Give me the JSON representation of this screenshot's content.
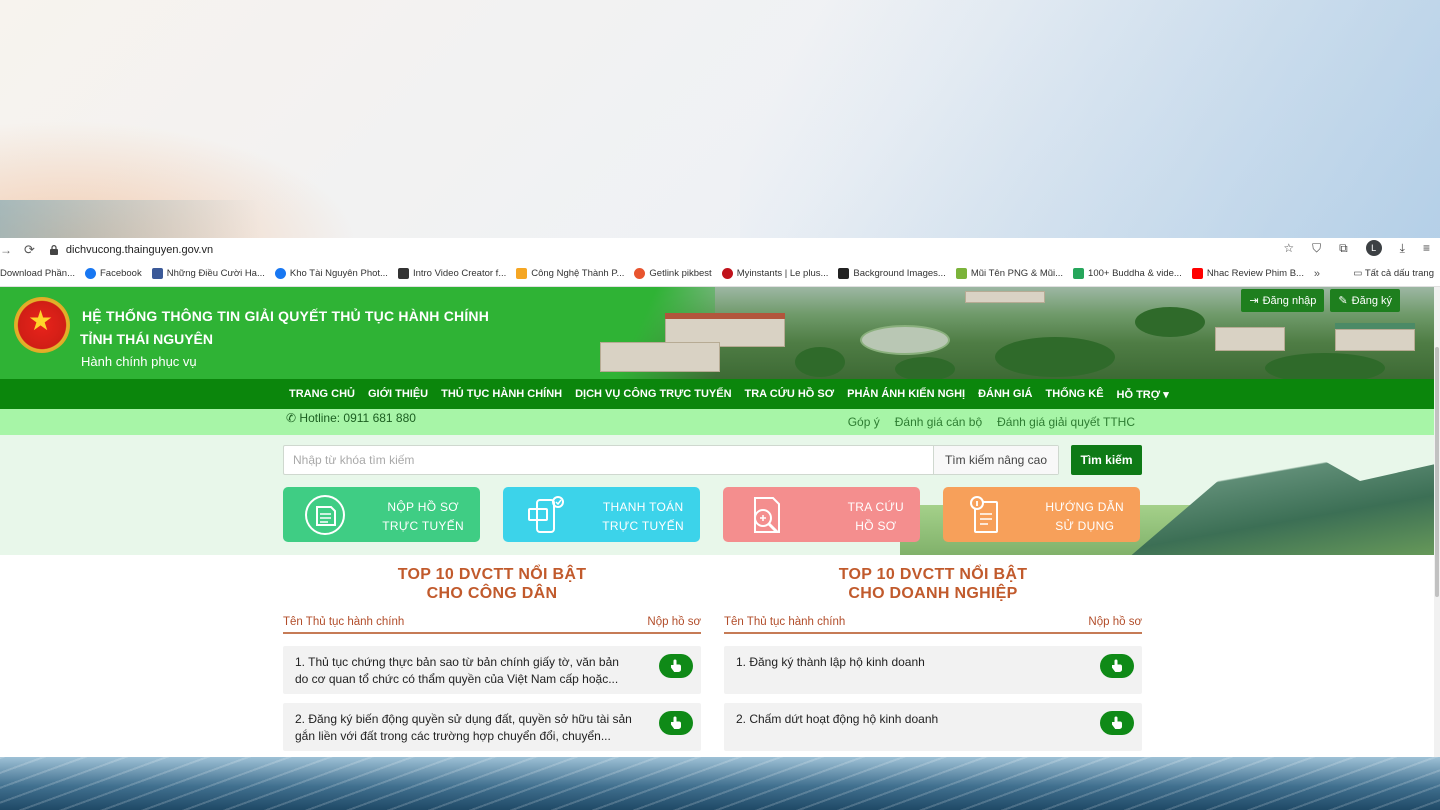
{
  "browser": {
    "url": "dichvucong.thainguyen.gov.vn",
    "avatar_initial": "L",
    "bookmarks": [
      {
        "label": "Download Phần...",
        "color": "#888888"
      },
      {
        "label": "Facebook",
        "color": "#1877f2"
      },
      {
        "label": "Những Điều Cười Ha...",
        "color": "#3b5998"
      },
      {
        "label": "Kho Tài Nguyên Phot...",
        "color": "#1877f2"
      },
      {
        "label": "Intro Video Creator f...",
        "color": "#333333"
      },
      {
        "label": "Công Nghệ Thành P...",
        "color": "#f5a623"
      },
      {
        "label": "Getlink pikbest",
        "color": "#e8542e"
      },
      {
        "label": "Myinstants | Le plus...",
        "color": "#c0121b"
      },
      {
        "label": "Background Images...",
        "color": "#222222"
      },
      {
        "label": "Mũi Tên PNG & Mũi...",
        "color": "#7bb33a"
      },
      {
        "label": "100+ Buddha & vide...",
        "color": "#26a65b"
      },
      {
        "label": "Nhac Review Phim B...",
        "color": "#ff0000"
      }
    ],
    "more_label": "»",
    "all_bookmarks_label": "Tất cả dấu trang"
  },
  "site": {
    "title_line1": "HỆ THỐNG THÔNG TIN GIẢI QUYẾT THỦ TỤC HÀNH CHÍNH",
    "title_line2": "TỈNH THÁI NGUYÊN",
    "slogan": "Hành chính phục vụ",
    "login_label": "Đăng nhập",
    "register_label": "Đăng ký"
  },
  "nav": [
    "TRANG CHỦ",
    "GIỚI THIỆU",
    "THỦ TỤC HÀNH CHÍNH",
    "DỊCH VỤ CÔNG TRỰC TUYẾN",
    "TRA CỨU HỒ SƠ",
    "PHẢN ÁNH KIẾN NGHỊ",
    "ĐÁNH GIÁ",
    "THỐNG KÊ",
    "HỖ TRỢ ▾"
  ],
  "subbar": {
    "hotline": "Hotline: 0911 681 880",
    "links": [
      "Góp ý",
      "Đánh giá cán bộ",
      "Đánh giá giải quyết TTHC"
    ]
  },
  "search": {
    "placeholder": "Nhập từ khóa tìm kiếm",
    "advanced_label": "Tìm kiếm nâng cao",
    "button_label": "Tìm kiếm"
  },
  "tiles": [
    {
      "line1": "NỘP HỒ SƠ",
      "line2": "TRỰC TUYẾN"
    },
    {
      "line1": "THANH TOÁN",
      "line2": "TRỰC TUYẾN"
    },
    {
      "line1": "TRA CỨU",
      "line2": "HỒ SƠ"
    },
    {
      "line1": "HƯỚNG DẪN",
      "line2": "SỬ DỤNG"
    }
  ],
  "top10": {
    "citizen": {
      "title_line1": "TOP 10 DVCTT NỔI BẬT",
      "title_line2": "CHO CÔNG DÂN",
      "col_name": "Tên Thủ tục hành chính",
      "col_action": "Nộp hồ sơ",
      "items": [
        "1. Thủ tục chứng thực bản sao từ bản chính giấy tờ, văn bản do cơ quan tổ chức có thẩm quyền của Việt Nam cấp hoặc...",
        "2. Đăng ký biến động quyền sử dụng đất, quyền sở hữu tài sản gắn liền với đất trong các trường hợp chuyển đổi, chuyển..."
      ]
    },
    "business": {
      "title_line1": "TOP 10 DVCTT NỔI BẬT",
      "title_line2": "CHO DOANH NGHIỆP",
      "col_name": "Tên Thủ tục hành chính",
      "col_action": "Nộp hồ sơ",
      "items": [
        "1. Đăng ký thành lập hộ kinh doanh",
        "2. Chấm dứt hoạt động hộ kinh doanh"
      ]
    }
  }
}
